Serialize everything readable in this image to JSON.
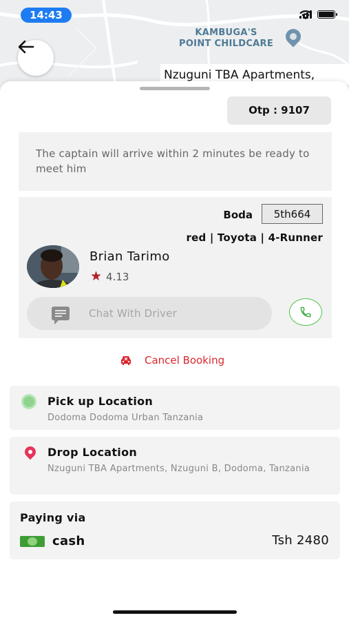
{
  "status_bar": {
    "time": "14:43"
  },
  "map": {
    "poi_line1": "KAMBUGA'S",
    "poi_line2": "POINT CHILDCARE",
    "street_label": "Nzuguni TBA Apartments,"
  },
  "otp": {
    "label": "Otp : 9107"
  },
  "notice": {
    "text": "The captain will arrive within 2 minutes be ready to meet him"
  },
  "driver": {
    "vehicle_type": "Boda",
    "plate": "5th664",
    "vehicle_desc": "red | Toyota | 4-Runner",
    "name": "Brian Tarimo",
    "rating": "4.13",
    "chat_label": "Chat With Driver"
  },
  "cancel": {
    "label": "Cancel Booking"
  },
  "pickup": {
    "title": "Pick up Location",
    "address": "Dodoma Dodoma Urban Tanzania"
  },
  "drop": {
    "title": "Drop Location",
    "address": "Nzuguni TBA Apartments, Nzuguni B, Dodoma, Tanzania"
  },
  "payment": {
    "label": "Paying via",
    "method": "cash",
    "amount": "Tsh 2480"
  },
  "colors": {
    "accent_blue": "#1e7cf2",
    "cancel_red": "#d9262c",
    "call_green": "#4cc24c",
    "drop_pin": "#e6335a"
  },
  "icons": [
    "back-arrow-icon",
    "map-pin-icon",
    "star-icon",
    "chat-icon",
    "phone-icon",
    "car-cancel-icon",
    "pickup-dot-icon",
    "drop-pin-icon",
    "cash-icon"
  ]
}
